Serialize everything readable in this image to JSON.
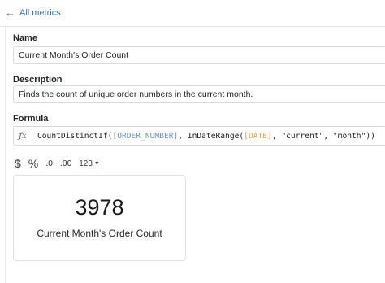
{
  "header": {
    "back_arrow": "←",
    "back_label": "All metrics"
  },
  "name": {
    "label": "Name",
    "value": "Current Month's Order Count"
  },
  "description": {
    "label": "Description",
    "value": "Finds the count of unique order numbers in the current month."
  },
  "formula": {
    "label": "Formula",
    "fx_icon": "ƒx",
    "tokens": {
      "fn": "CountDistinctIf(",
      "ref1": "[ORDER_NUMBER]",
      "mid": ", InDateRange(",
      "ref2": "[DATE]",
      "tail": ", \"current\", \"month\"))"
    }
  },
  "format_toolbar": {
    "currency": "$",
    "percent": "%",
    "decrease_decimals": ".0",
    "increase_decimals": ".00",
    "number_format": "123"
  },
  "preview": {
    "value": "3978",
    "label": "Current Month's Order Count"
  },
  "colors": {
    "link": "#2f6fd6",
    "field_ref": "#6a8fd8",
    "date_ref": "#e0a23a"
  }
}
